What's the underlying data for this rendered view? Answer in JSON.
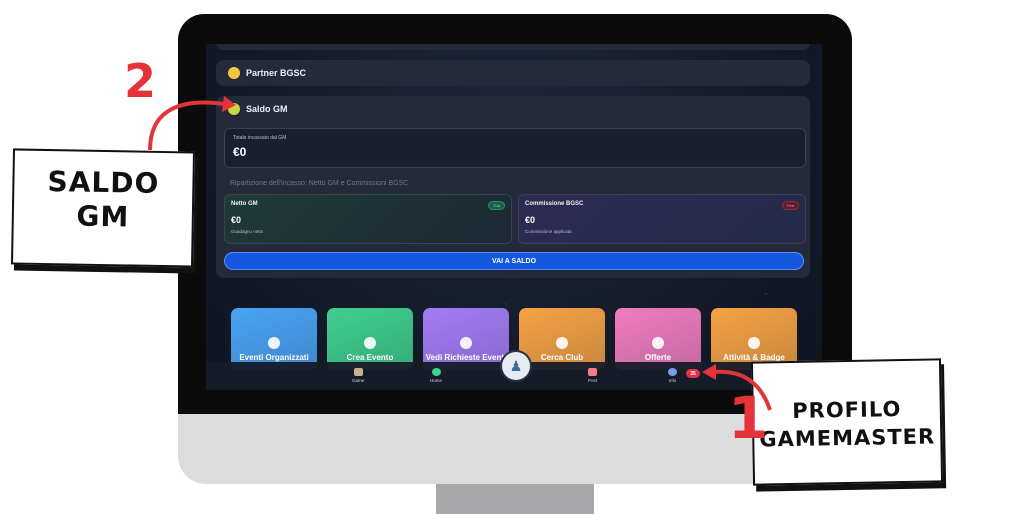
{
  "screen": {
    "partner_section": {
      "title": "Partner BGSC"
    },
    "saldo_section": {
      "title": "Saldo GM",
      "totale_label": "Totale incassato dal GM",
      "totale_value": "€0",
      "ripartizione": "Ripartizione dell'incasso: Netto GM e Commissioni BGSC",
      "netto": {
        "title": "Netto GM",
        "value": "€0",
        "sub": "Guadagno netto",
        "pill": "Tua"
      },
      "commissione": {
        "title": "Commissione BGSC",
        "value": "€0",
        "sub": "Commissione applicata",
        "pill": "Fee"
      },
      "button": "VAI A SALDO"
    },
    "tiles": [
      {
        "label": "Eventi Organizzati",
        "color": "#4aa3f5"
      },
      {
        "label": "Crea Evento",
        "color": "#3fcf8e"
      },
      {
        "label": "Vedi Richieste Eventi",
        "color": "#a27cf5"
      },
      {
        "label": "Cerca Club",
        "color": "#f5a243"
      },
      {
        "label": "Offerte",
        "color": "#f07cc0"
      },
      {
        "label": "Attività & Badge",
        "color": "#f5a243"
      }
    ],
    "nav": {
      "game": "Game",
      "home": "Home",
      "post": "Post",
      "info": "Info",
      "badge": "35"
    }
  },
  "annotations": {
    "left_number": "2",
    "left_flag_line1": "SALDO",
    "left_flag_line2": "GM",
    "right_number": "1",
    "right_flag_line1": "PROFILO",
    "right_flag_line2": "GAMEMASTER"
  },
  "colors": {
    "accent_blue": "#1558e0",
    "annotation_red": "#e5333a"
  }
}
